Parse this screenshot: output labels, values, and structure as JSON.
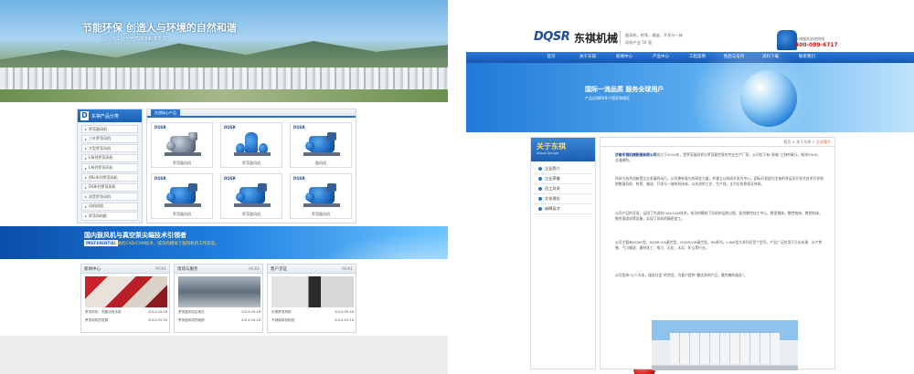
{
  "left": {
    "hero": {
      "title": "节能环保 创造人与环境的自然和谐",
      "subtitle": "让现代工业与自然环境和谐发展"
    },
    "sidebar": {
      "letter": "D",
      "title": "东祺产品分类",
      "items": [
        "罗茨鼓风机",
        "三叶罗茨风机",
        "大型罗茨风机",
        "L系列罗茨风机",
        "L系列罗茨风机",
        "ARL系列罗茨风机",
        "DS系列罗茨风机",
        "消音罗茨风机",
        "风机机组",
        "罗茨风机配"
      ]
    },
    "products": {
      "title": "东祺核心产品",
      "brand": "DQSR",
      "items": [
        "罗茨鼓风机",
        "罗茨鼓风机",
        "鼓风机",
        "罗茨鼓风机",
        "罗茨鼓风机",
        "罗茨鼓风机"
      ]
    },
    "banner": {
      "title": "国内鼓风机与真空泵尖端技术引领者",
      "prefix": "PREFERENTIAL",
      "text": "先进的CAD/CAM技术，成功的模拟了鼓风机的工作状态。"
    },
    "boxes": [
      {
        "title": "新闻中心",
        "more": "MORE",
        "items": [
          [
            "罗茨风机：完善化的手段",
            "2014-09-16"
          ],
          [
            "罗茨风机的发展",
            "2014-09-16"
          ]
        ]
      },
      {
        "title": "现场与服务",
        "more": "MORE",
        "items": [
          [
            "罗茨鼓风机应用在",
            "2014-09-16"
          ],
          [
            "罗茨鼓风机的维修",
            "2014-09-16"
          ]
        ]
      },
      {
        "title": "客户见证",
        "more": "MORE",
        "items": [
          [
            "东祺罗茨风机",
            "2014-09-16"
          ],
          [
            "不锈钢风机检测",
            "2014-09-16"
          ]
        ]
      }
    ]
  },
  "right": {
    "logo": {
      "en": "DQSR",
      "cn": "东祺机械"
    },
    "slogan": [
      "鼓风机，射泵，输送，开发与一体",
      "风机产业 50 强"
    ],
    "tel_label": "东祺服务咨询热线",
    "tel": "400-089-6717",
    "nav": [
      "首页",
      "关于东祺",
      "新闻中心",
      "产品中心",
      "工程案例",
      "售后与支持",
      "资料下载",
      "联系我们"
    ],
    "banner": {
      "title": "国际一流品质  服务全球用户",
      "sub1": "产品远销60多个国家和地区",
      "sub2": ""
    },
    "sidebar": {
      "title": "关于东祺",
      "en": "About Dongqi",
      "items": [
        "企业简介",
        "企业荣誉",
        "员工风采",
        "文化理念",
        "诚聘英才"
      ]
    },
    "breadcrumb": {
      "prefix": "首页 > 关于东祺 > ",
      "current": "企业简介"
    },
    "company": "济南东祺机械制造有限公司",
    "paragraphs": [
      "成立于2010年，是罗茨鼓风机与罗茨真空泵的专业生产厂家。公司位于有“泉城”之称的章丘，毗邻G309，交通便利。",
      "科技与技术创新是企业发展的动力，公司拥有强大的研发力量，并建立以科研开发为中心，国际开发部为主体的多层次开发式技术开发和销售鼓风机、射泵、输送、开发与一体的科技体，以先进的工艺，生产线，全方位的质保证体系。",
      "公司产品的开发，运用了先进的CAD/CAM技术，成功的模拟了风机的运转过程，配合数控加工中心，数显镗床，数控铣床，数控机床，数控滚齿机等设备，实现了风机的精密加工。",
      "公司主要有DQSR型，DQSR-V/A真空型，DQSR-V/B真空型，RR系列，L-WD型大系列近百个型号，产品广泛应用于污水处理、水产养殖、气力输送、建材化工、电力、石化、水泥、矿山等行业。",
      "公司坚持“以人为本，服务社会”的宗旨，为客户提供“最优质的产品，最完善的服务”。"
    ]
  }
}
